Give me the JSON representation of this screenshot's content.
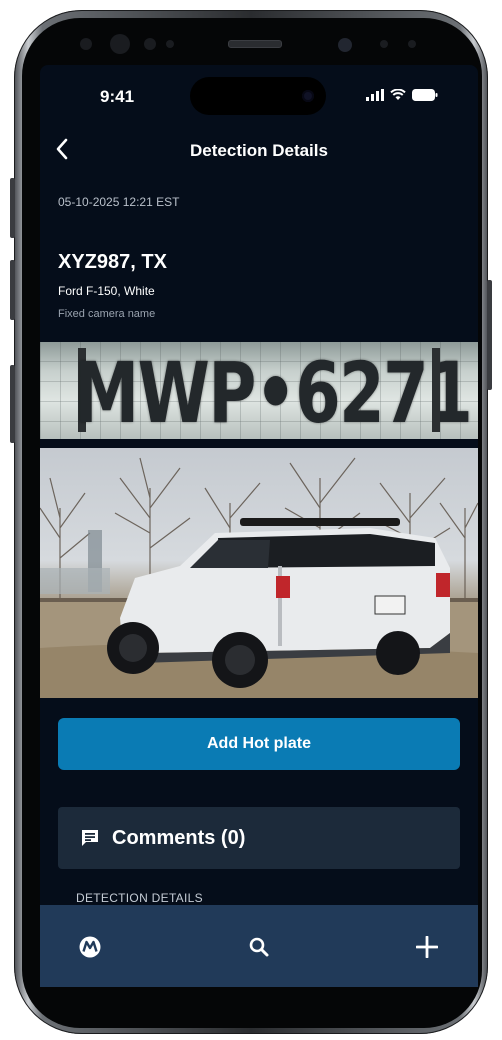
{
  "status_bar": {
    "time": "9:41"
  },
  "header": {
    "title": "Detection Details"
  },
  "detection": {
    "timestamp": "05-10-2025 12:21 EST",
    "plate": "XYZ987, TX",
    "vehicle": "Ford F-150, White",
    "camera": "Fixed camera name",
    "plate_crop_text": "MWP•6271"
  },
  "actions": {
    "add_hot_plate": "Add Hot plate"
  },
  "comments": {
    "label": "Comments (0)"
  },
  "sections": {
    "details_label": "DETECTION DETAILS"
  },
  "colors": {
    "background": "#050d1a",
    "primary_button": "#0a7bb4",
    "card": "#1c2a3a",
    "bottom_nav": "#213a59"
  },
  "icons": [
    "back-icon",
    "signal-icon",
    "wifi-icon",
    "battery-icon",
    "comment-icon",
    "motorola-logo-icon",
    "search-icon",
    "plus-icon"
  ]
}
